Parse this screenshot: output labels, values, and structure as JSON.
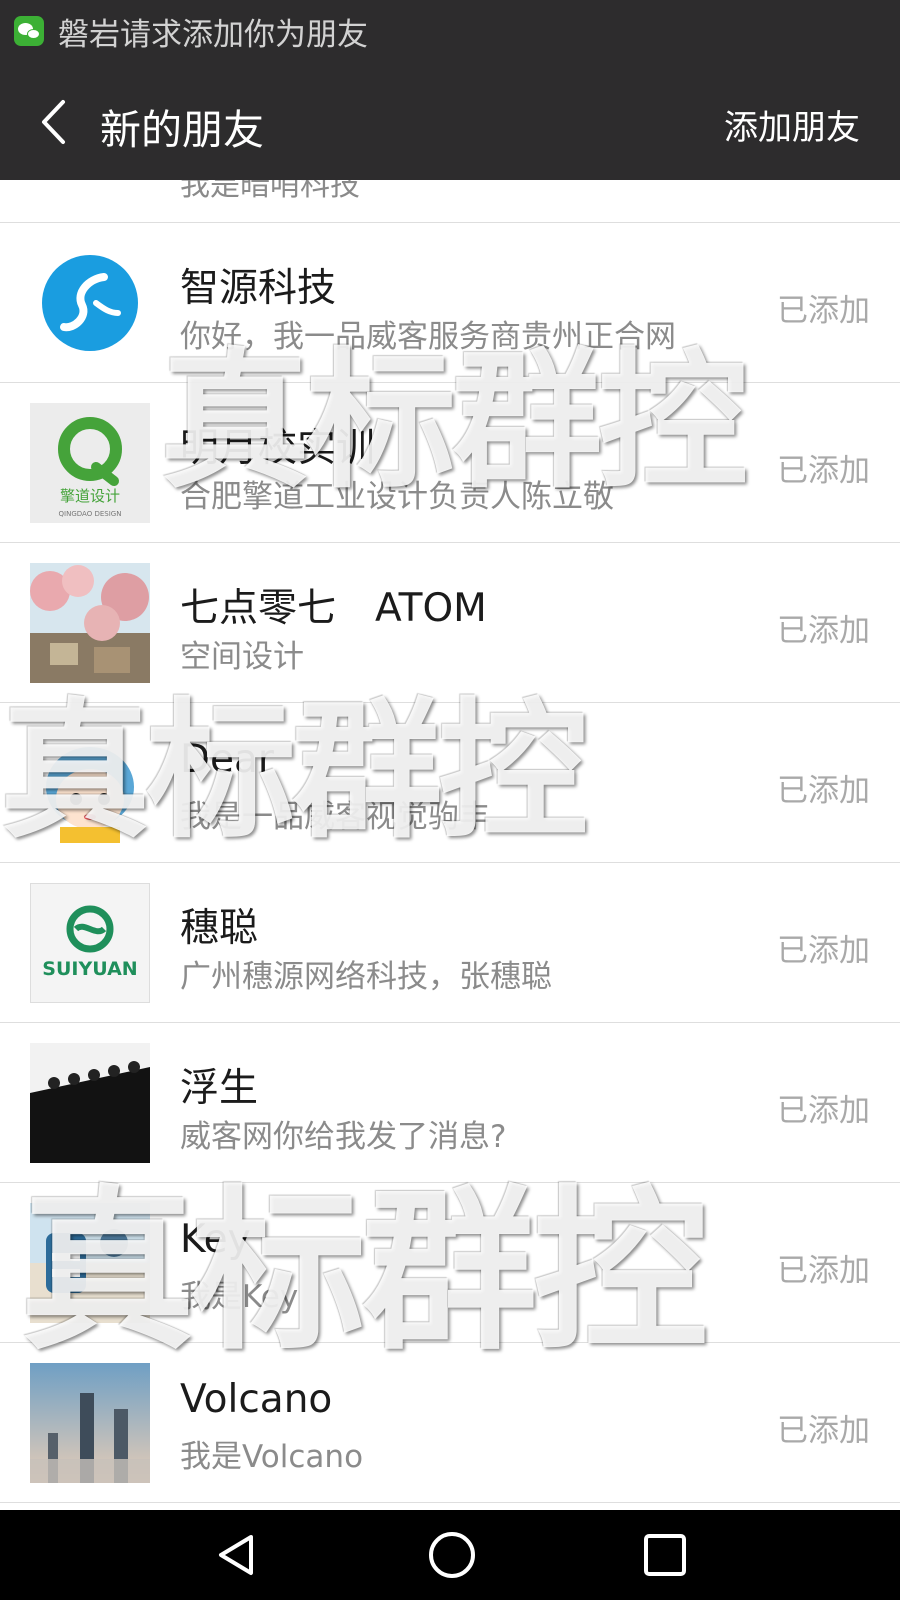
{
  "status_bar": {
    "notification_text": "磐岩请求添加你为朋友"
  },
  "header": {
    "title": "新的朋友",
    "action_label": "添加朋友"
  },
  "partial_row": {
    "subtitle": "我是暗哨科技"
  },
  "friends": [
    {
      "name": "智源科技",
      "subtitle": "你好，我一品威客服务商贵州正合网",
      "status": "已添加"
    },
    {
      "name": "明月校实训",
      "subtitle": "合肥擎道工业设计负责人陈立敬",
      "status": "已添加",
      "avatar_text": "擎道设计",
      "avatar_subtext": "QINGDAO DESIGN"
    },
    {
      "name": "七点零七　ATOM",
      "subtitle": "空间设计",
      "status": "已添加"
    },
    {
      "name": "Dear",
      "subtitle": "我是一品威客视觉驹丰",
      "status": "已添加"
    },
    {
      "name": "穗聪",
      "subtitle": "广州穗源网络科技，张穗聪",
      "status": "已添加",
      "avatar_text": "SUIYUAN"
    },
    {
      "name": "浮生",
      "subtitle": "威客网你给我发了消息?",
      "status": "已添加"
    },
    {
      "name": "Key",
      "subtitle": "我是Key",
      "status": "已添加"
    },
    {
      "name": "Volcano",
      "subtitle": "我是Volcano",
      "status": "已添加"
    }
  ],
  "watermark": {
    "text": "真标群控"
  },
  "colors": {
    "bar_bg": "#2d2c2d",
    "wechat_green": "#3cb035",
    "divider": "#dedede",
    "status_grey": "#a9a9a9"
  }
}
